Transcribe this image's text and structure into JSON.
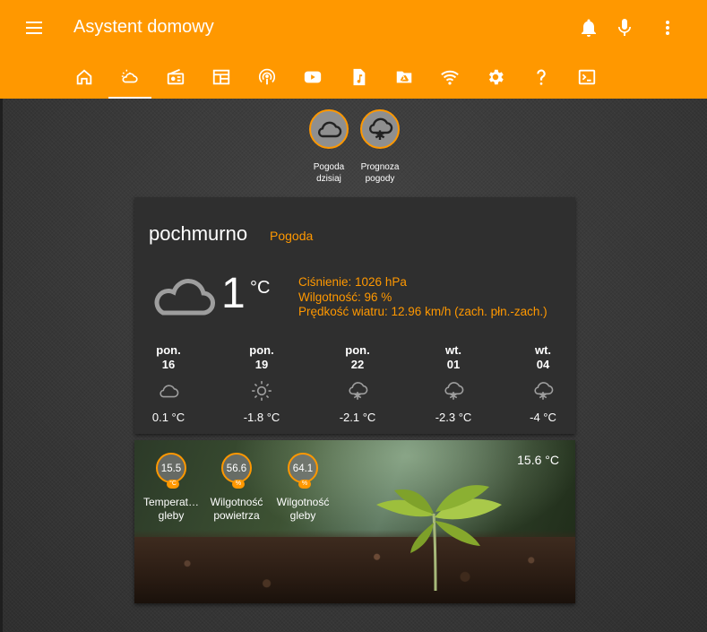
{
  "header": {
    "title": "Asystent domowy",
    "icons": [
      "menu-icon",
      "bell-icon",
      "microphone-icon",
      "more-vert-icon"
    ]
  },
  "tabs": [
    {
      "icon": "home-icon"
    },
    {
      "icon": "weather-partly-cloudy-icon",
      "active": true
    },
    {
      "icon": "radio-icon"
    },
    {
      "icon": "dashboard-icon"
    },
    {
      "icon": "podcast-icon"
    },
    {
      "icon": "youtube-icon"
    },
    {
      "icon": "music-file-icon"
    },
    {
      "icon": "google-drive-folder-icon"
    },
    {
      "icon": "wifi-icon"
    },
    {
      "icon": "settings-icon"
    },
    {
      "icon": "help-icon"
    },
    {
      "icon": "console-icon"
    }
  ],
  "quick_buttons": [
    {
      "label_line1": "Pogoda",
      "label_line2": "dzisiaj",
      "icon": "cloud-icon"
    },
    {
      "label_line1": "Prognoza",
      "label_line2": "pogody",
      "icon": "snow-cloud-icon"
    }
  ],
  "weather": {
    "condition": "pochmurno",
    "name": "Pogoda",
    "temperature": "1",
    "unit": "°C",
    "pressure": "Ciśnienie: 1026 hPa",
    "humidity": "Wilgotność: 96 %",
    "wind": "Prędkość wiatru: 12.96 km/h (zach. płn.-zach.)",
    "forecast": [
      {
        "day": "pon.",
        "date": "16",
        "icon": "cloud-icon",
        "temp": "0.1 °C"
      },
      {
        "day": "pon.",
        "date": "19",
        "icon": "sunny-icon",
        "temp": "-1.8 °C"
      },
      {
        "day": "pon.",
        "date": "22",
        "icon": "snow-icon",
        "temp": "-2.1 °C"
      },
      {
        "day": "wt.",
        "date": "01",
        "icon": "snow-icon",
        "temp": "-2.3 °C"
      },
      {
        "day": "wt.",
        "date": "04",
        "icon": "snow-icon",
        "temp": "-4 °C"
      }
    ]
  },
  "sensors": {
    "outside_temp": "15.6 °C",
    "gauges": [
      {
        "value": "15.5",
        "unit": "°C",
        "label_line1": "Temperat…",
        "label_line2": "gleby"
      },
      {
        "value": "56.6",
        "unit": "%",
        "label_line1": "Wilgotność",
        "label_line2": "powietrza"
      },
      {
        "value": "64.1",
        "unit": "%",
        "label_line1": "Wilgotność",
        "label_line2": "gleby"
      }
    ]
  },
  "colors": {
    "accent": "#ff9800",
    "card": "#2f2f2f",
    "background": "#3b3b3b"
  }
}
